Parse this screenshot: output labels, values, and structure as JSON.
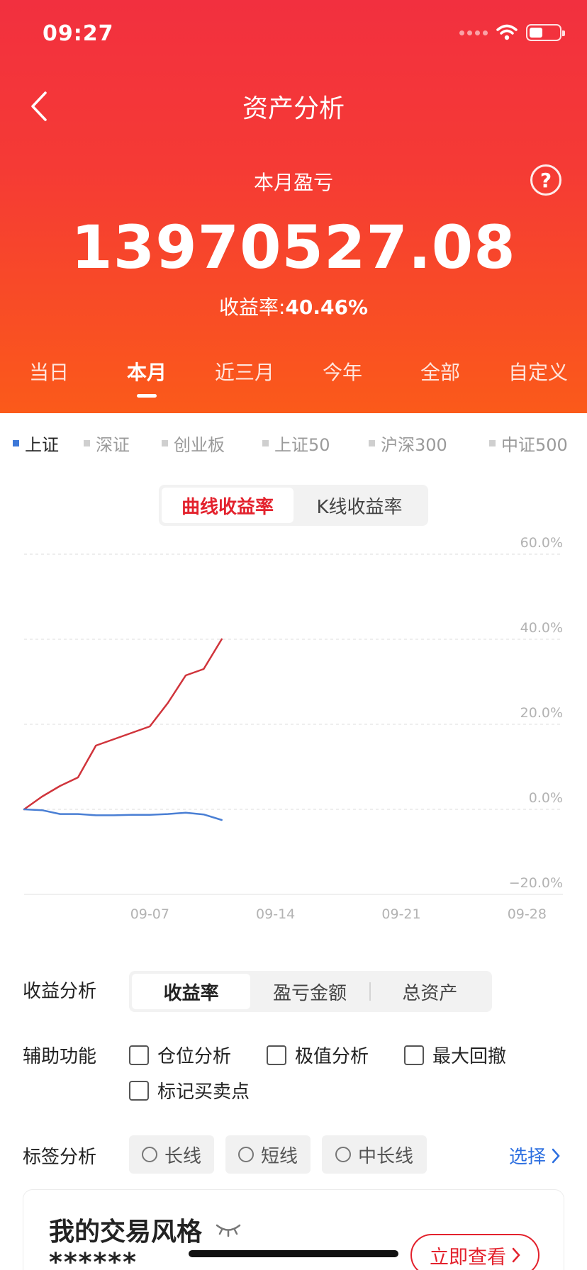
{
  "status_bar": {
    "time": "09:27"
  },
  "header": {
    "title": "资产分析",
    "pnl_label": "本月盈亏",
    "pnl_value": "13970527.08",
    "yield_label": "收益率:",
    "yield_value": "40.46%",
    "help_symbol": "?"
  },
  "period_tabs": [
    {
      "label": "当日",
      "active": false
    },
    {
      "label": "本月",
      "active": true
    },
    {
      "label": "近三月",
      "active": false
    },
    {
      "label": "今年",
      "active": false
    },
    {
      "label": "全部",
      "active": false
    },
    {
      "label": "自定义",
      "active": false
    }
  ],
  "index_tabs": [
    {
      "label": "上证",
      "active": true
    },
    {
      "label": "深证",
      "active": false
    },
    {
      "label": "创业板",
      "active": false
    },
    {
      "label": "上证50",
      "active": false
    },
    {
      "label": "沪深300",
      "active": false
    },
    {
      "label": "中证500",
      "active": false
    }
  ],
  "chart_toggle": [
    {
      "label": "曲线收益率",
      "active": true
    },
    {
      "label": "K线收益率",
      "active": false
    }
  ],
  "colors": {
    "accent": "#e3222d",
    "account_line": "#d0343b",
    "index_line": "#4a7fd4",
    "link": "#2d6fe0"
  },
  "chart_data": {
    "type": "line",
    "y_tick_labels": [
      "60.0%",
      "40.0%",
      "20.0%",
      "0.0%",
      "−20.0%"
    ],
    "y_ticks": [
      60,
      40,
      20,
      0,
      -20
    ],
    "ylim": [
      -20,
      60
    ],
    "x_tick_labels": [
      "09-07",
      "09-14",
      "09-21",
      "09-28"
    ],
    "x_tick_positions": [
      7,
      14,
      21,
      28
    ],
    "xlim": [
      0,
      30
    ],
    "grid": true,
    "series": [
      {
        "values": [
          [
            0,
            0
          ],
          [
            1,
            3
          ],
          [
            2,
            5.5
          ],
          [
            3,
            7.5
          ],
          [
            4,
            15
          ],
          [
            5,
            16.5
          ],
          [
            6,
            18
          ],
          [
            7,
            19.5
          ],
          [
            8,
            25
          ],
          [
            9,
            31.5
          ],
          [
            10,
            33
          ],
          [
            11,
            40
          ]
        ]
      },
      {
        "values": [
          [
            0,
            0
          ],
          [
            1,
            -0.2
          ],
          [
            2,
            -1.1
          ],
          [
            3,
            -1.1
          ],
          [
            4,
            -1.4
          ],
          [
            5,
            -1.4
          ],
          [
            6,
            -1.3
          ],
          [
            7,
            -1.3
          ],
          [
            8,
            -1.1
          ],
          [
            9,
            -0.8
          ],
          [
            10,
            -1.2
          ],
          [
            11,
            -2.5
          ]
        ]
      }
    ]
  },
  "profit_analysis": {
    "label": "收益分析",
    "options": [
      {
        "label": "收益率",
        "active": true
      },
      {
        "label": "盈亏金额",
        "active": false
      },
      {
        "label": "总资产",
        "active": false
      }
    ]
  },
  "aux_functions": {
    "label": "辅助功能",
    "items": [
      "仓位分析",
      "极值分析",
      "最大回撤",
      "标记买卖点"
    ]
  },
  "tag_analysis": {
    "label": "标签分析",
    "tags": [
      "长线",
      "短线",
      "中长线"
    ],
    "select_label": "选择"
  },
  "trading_style": {
    "title": "我的交易风格",
    "masked": "******",
    "button_label": "立即查看"
  }
}
